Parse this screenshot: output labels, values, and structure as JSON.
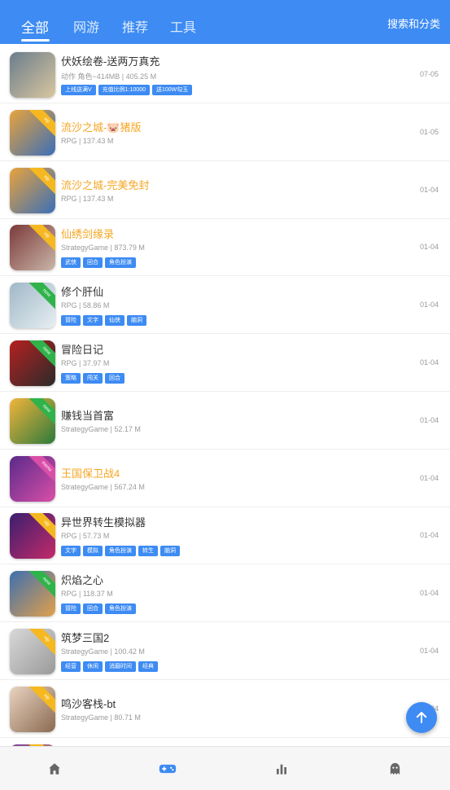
{
  "header": {
    "tabs": [
      {
        "label": "全部",
        "active": true
      },
      {
        "label": "网游",
        "active": false
      },
      {
        "label": "推荐",
        "active": false
      },
      {
        "label": "工具",
        "active": false
      }
    ],
    "action_label": "搜索和分类"
  },
  "games": [
    {
      "title": "伏妖绘卷-送两万真充",
      "title_color": "normal",
      "meta": "动作 角色~414MB | 405.25 M",
      "tags": [
        "上线送满V",
        "充值比例1:10000",
        "送100W勾玉"
      ],
      "date": "07-05",
      "badge": "",
      "icon_colors": [
        "#6a7d8c",
        "#d9c6a0"
      ]
    },
    {
      "title": "流沙之城-🐷猪版",
      "title_color": "orange",
      "meta": "RPG | 137.43 M",
      "tags": [],
      "date": "01-05",
      "badge": "vip",
      "icon_colors": [
        "#e8a33c",
        "#3a6fb8"
      ]
    },
    {
      "title": "流沙之城-完美免封",
      "title_color": "orange",
      "meta": "RPG | 137.43 M",
      "tags": [],
      "date": "01-04",
      "badge": "vip",
      "icon_colors": [
        "#e8a33c",
        "#3a6fb8"
      ]
    },
    {
      "title": "仙绣剑缘录",
      "title_color": "orange",
      "meta": "StrategyGame | 873.79 M",
      "tags": [
        "武侠",
        "回合",
        "角色扮演"
      ],
      "date": "01-04",
      "badge": "vip",
      "icon_colors": [
        "#7c3a3a",
        "#c9b6a8"
      ]
    },
    {
      "title": "修个肝仙",
      "title_color": "normal",
      "meta": "RPG | 58.86 M",
      "tags": [
        "冒险",
        "文字",
        "仙侠",
        "脑洞"
      ],
      "date": "01-04",
      "badge": "new",
      "icon_colors": [
        "#9fb8c6",
        "#e7eef2"
      ]
    },
    {
      "title": "冒险日记",
      "title_color": "normal",
      "meta": "RPG | 37.97 M",
      "tags": [
        "策略",
        "闯关",
        "回合"
      ],
      "date": "01-04",
      "badge": "new",
      "icon_colors": [
        "#b52020",
        "#2b2b2b"
      ]
    },
    {
      "title": "赚钱当首富",
      "title_color": "normal",
      "meta": "StrategyGame | 52.17 M",
      "tags": [],
      "date": "01-04",
      "badge": "new",
      "icon_colors": [
        "#f2b43b",
        "#2c7a3c"
      ]
    },
    {
      "title": "王国保卫战4",
      "title_color": "orange",
      "meta": "StrategyGame | 567.24 M",
      "tags": [],
      "date": "01-04",
      "badge": "menu",
      "icon_colors": [
        "#5a2a8a",
        "#d94fa8"
      ]
    },
    {
      "title": "异世界转生模拟器",
      "title_color": "normal",
      "meta": "RPG | 57.73 M",
      "tags": [
        "文字",
        "模拟",
        "角色扮演",
        "转生",
        "脑洞"
      ],
      "date": "01-04",
      "badge": "vip",
      "icon_colors": [
        "#3a1f6e",
        "#c42a6a"
      ]
    },
    {
      "title": "炽焰之心",
      "title_color": "normal",
      "meta": "RPG | 118.37 M",
      "tags": [
        "冒险",
        "回合",
        "角色扮演"
      ],
      "date": "01-04",
      "badge": "new",
      "icon_colors": [
        "#3d6fb0",
        "#e2a04a"
      ]
    },
    {
      "title": "筑梦三国2",
      "title_color": "normal",
      "meta": "StrategyGame | 100.42 M",
      "tags": [
        "经营",
        "休闲",
        "消磨时间",
        "经典"
      ],
      "date": "01-04",
      "badge": "vip",
      "icon_colors": [
        "#d8d8d8",
        "#9a9a9a"
      ]
    },
    {
      "title": "鸣沙客栈-bt",
      "title_color": "normal",
      "meta": "StrategyGame | 80.71 M",
      "tags": [],
      "date": "01-04",
      "badge": "vip",
      "icon_colors": [
        "#e9d3c0",
        "#8a6a52"
      ]
    },
    {
      "title": "",
      "title_color": "normal",
      "meta": "",
      "tags": [],
      "date": "",
      "badge": "vip",
      "icon_colors": [
        "#7a3aa0",
        "#e0b040"
      ]
    }
  ],
  "fab": {
    "icon": "arrow-up-icon"
  },
  "bottom_nav": [
    {
      "icon": "home-icon",
      "active": false
    },
    {
      "icon": "gamepad-icon",
      "active": true
    },
    {
      "icon": "bar-chart-icon",
      "active": false
    },
    {
      "icon": "ghost-icon",
      "active": false
    }
  ],
  "colors": {
    "primary": "#3d8bf3",
    "orange": "#f5a623",
    "vip_badge": "#f5b820",
    "new_badge": "#2fb34a",
    "menu_badge": "#d94fa8"
  }
}
